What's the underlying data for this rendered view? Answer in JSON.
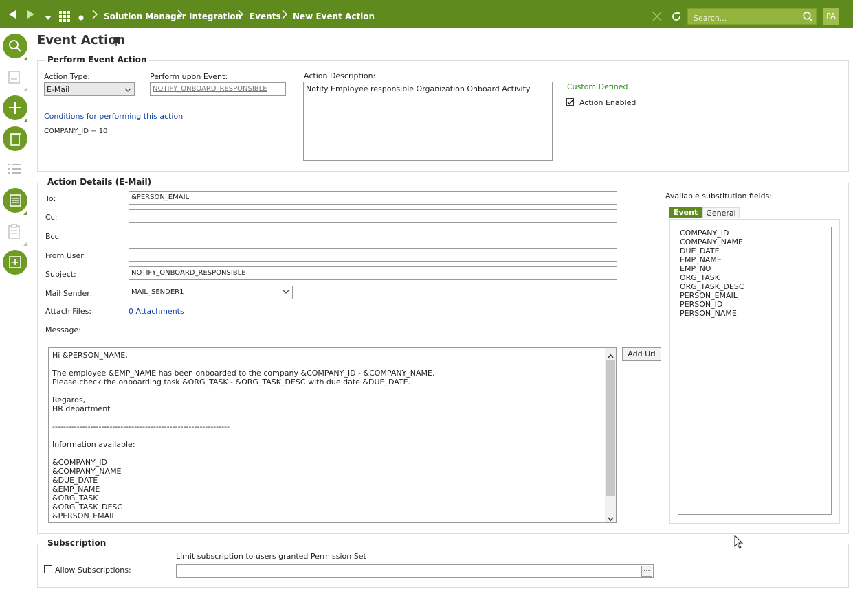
{
  "breadcrumbs": [
    "Solution Manager",
    "Integration",
    "Events",
    "New Event Action"
  ],
  "search": {
    "placeholder": "Search..."
  },
  "user": {
    "initials": "PA"
  },
  "page_title": "Event Action",
  "perform": {
    "title": "Perform Event Action",
    "action_type_label": "Action Type:",
    "action_type_value": "E-Mail",
    "perform_upon_label": "Perform upon Event:",
    "perform_upon_value": "NOTIFY_ONBOARD_RESPONSIBLE",
    "conditions_link": "Conditions for performing this action",
    "condition_text": "COMPANY_ID = 10",
    "description_label": "Action Description:",
    "description_value": "Notify Employee responsible Organization Onboard Activity",
    "custom_defined": "Custom Defined",
    "action_enabled_label": "Action Enabled",
    "action_enabled": true
  },
  "details": {
    "title": "Action Details (E-Mail)",
    "to_label": "To:",
    "to_value": "&PERSON_EMAIL",
    "cc_label": "Cc:",
    "cc_value": "",
    "bcc_label": "Bcc:",
    "bcc_value": "",
    "from_user_label": "From User:",
    "from_user_value": "",
    "subject_label": "Subject:",
    "subject_value": "NOTIFY_ONBOARD_RESPONSIBLE",
    "mail_sender_label": "Mail Sender:",
    "mail_sender_value": "MAIL_SENDER1",
    "attach_label": "Attach Files:",
    "attach_link": "0 Attachments",
    "message_label": "Message:",
    "add_url": "Add Url",
    "message_lines": [
      "Hi &PERSON_NAME,",
      "",
      "The employee &EMP_NAME has been onboarded to the company &COMPANY_ID - &COMPANY_NAME.",
      "Please check the onboarding task &ORG_TASK - &ORG_TASK_DESC with due date &DUE_DATE.",
      "",
      "Regards,",
      "HR department",
      "",
      "-----------------------------------------------------------------",
      "",
      "Information available:",
      "",
      "&COMPANY_ID",
      "&COMPANY_NAME",
      "&DUE_DATE",
      "&EMP_NAME",
      "&ORG_TASK",
      "&ORG_TASK_DESC",
      "&PERSON_EMAIL"
    ],
    "substitution_label": "Available substitution fields:",
    "tabs": [
      "Event",
      "General"
    ],
    "active_tab": "Event",
    "fields": [
      "COMPANY_ID",
      "COMPANY_NAME",
      "DUE_DATE",
      "EMP_NAME",
      "EMP_NO",
      "ORG_TASK",
      "ORG_TASK_DESC",
      "PERSON_EMAIL",
      "PERSON_ID",
      "PERSON_NAME"
    ]
  },
  "subscription": {
    "title": "Subscription",
    "allow_label": "Allow Subscriptions:",
    "allow_checked": false,
    "limit_label": "Limit subscription to users granted Permission Set",
    "limit_value": "",
    "browse_label": "..."
  },
  "colors": {
    "brand": "#5f8a1e",
    "accent_button": "#6f9a24",
    "link": "#0a3ea6",
    "custom_defined": "#2f8a17"
  }
}
